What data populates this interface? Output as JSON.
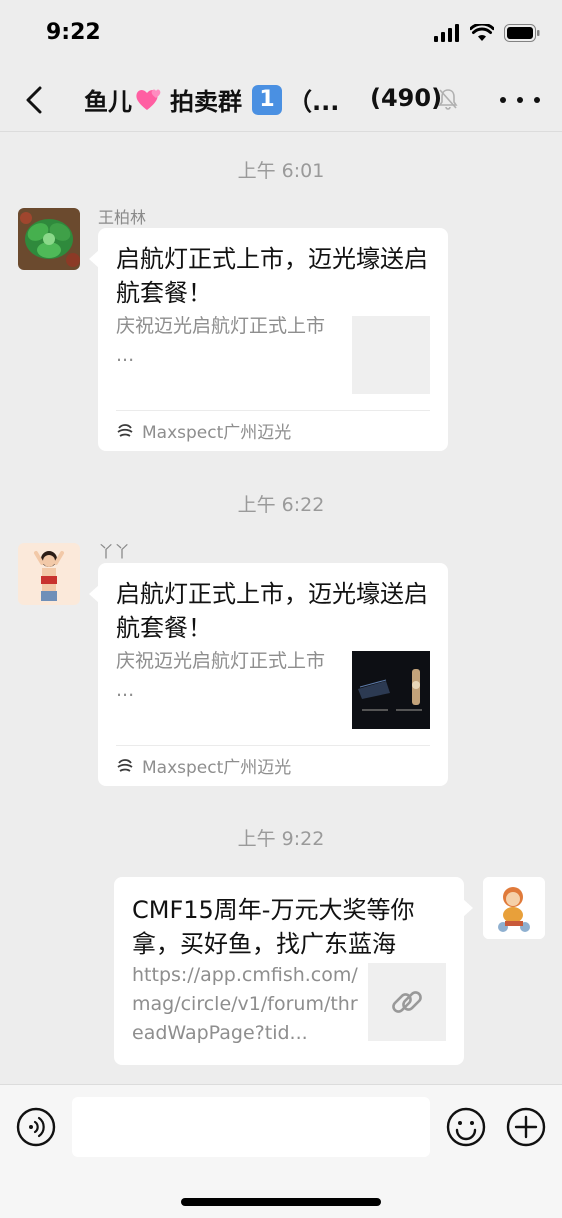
{
  "status_bar": {
    "time": "9:22"
  },
  "nav": {
    "title_prefix": "鱼儿",
    "title_middle": "拍卖群",
    "title_keycap": "1",
    "title_suffix": "（...",
    "member_count": "(490)"
  },
  "messages": [
    {
      "timestamp": "上午 6:01",
      "sender": "王柏林",
      "title": "启航灯正式上市，迈光壕送启航套餐！",
      "desc": "庆祝迈光启航灯正式上市 ...",
      "source": "Maxspect广州迈光"
    },
    {
      "timestamp": "上午 6:22",
      "sender": "丫丫",
      "title": "启航灯正式上市，迈光壕送启航套餐！",
      "desc": "庆祝迈光启航灯正式上市 ...",
      "source": "Maxspect广州迈光"
    },
    {
      "timestamp": "上午 9:22",
      "sender": "",
      "title": "CMF15周年-万元大奖等你拿，买好鱼，找广东蓝海",
      "desc": "https://app.cmfish.com/mag/circle/v1/forum/threadWapPage?tid...",
      "source": ""
    }
  ],
  "input_bar": {
    "placeholder": ""
  },
  "colors": {
    "background": "#EDEDED",
    "bubble": "#FFFFFF",
    "accent_pink": "#FF5FA2",
    "keycap_blue": "#4A90E2"
  },
  "icons": [
    "back-chevron-icon",
    "heart-icon",
    "mute-bell-icon",
    "more-dots-icon",
    "voice-icon",
    "emoji-icon",
    "plus-icon",
    "link-icon",
    "maxspect-logo-icon"
  ]
}
